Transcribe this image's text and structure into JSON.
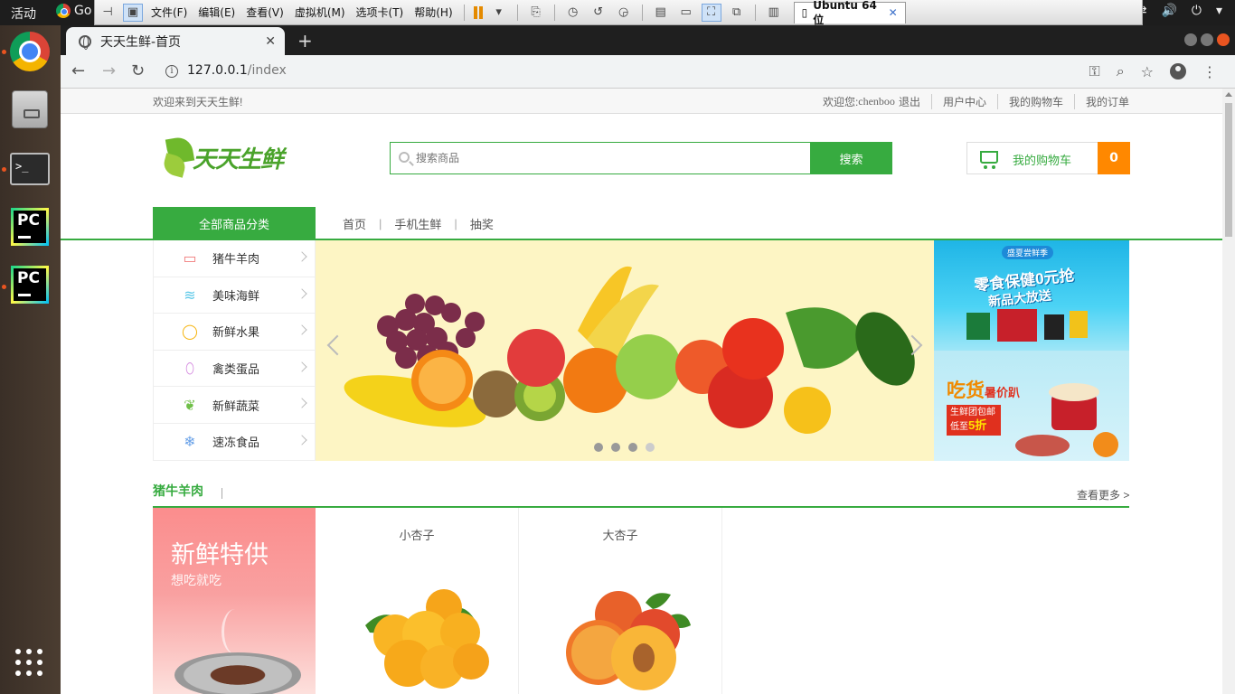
{
  "system": {
    "activities_label": "活动",
    "topbar_app_label": "Go"
  },
  "vmware": {
    "menus": [
      "文件(F)",
      "编辑(E)",
      "查看(V)",
      "虚拟机(M)",
      "选项卡(T)",
      "帮助(H)"
    ],
    "vm_tab_label": "Ubuntu 64 位"
  },
  "browser": {
    "tab_title": "天天生鲜-首页",
    "url_host": "127.0.0.1",
    "url_path": "/index"
  },
  "site": {
    "welcome": "欢迎来到天天生鲜!",
    "greeting": "欢迎您:",
    "username": "chenboo",
    "logout": "退出",
    "links": [
      "用户中心",
      "我的购物车",
      "我的订单"
    ],
    "logo_text": "天天生鲜",
    "search": {
      "placeholder": "搜索商品",
      "button": "搜索"
    },
    "cart": {
      "label": "我的购物车",
      "count": "0"
    },
    "all_categories": "全部商品分类",
    "nav": [
      "首页",
      "手机生鲜",
      "抽奖"
    ],
    "categories": [
      {
        "label": "猪牛羊肉",
        "icon": "meat-icon",
        "color": "#f07b7b"
      },
      {
        "label": "美味海鲜",
        "icon": "seafood-icon",
        "color": "#5cc8e8"
      },
      {
        "label": "新鲜水果",
        "icon": "fruit-icon",
        "color": "#f6b614"
      },
      {
        "label": "禽类蛋品",
        "icon": "egg-icon",
        "color": "#d58be0"
      },
      {
        "label": "新鲜蔬菜",
        "icon": "vegetable-icon",
        "color": "#6fbf47"
      },
      {
        "label": "速冻食品",
        "icon": "snowflake-icon",
        "color": "#6aa2e8"
      }
    ],
    "carousel": {
      "dots": 4,
      "active_dot": 4
    },
    "ads": {
      "ad1_tag": "盛夏尝鲜季",
      "ad1_title": "零食保健0元抢",
      "ad1_sub": "新品大放送",
      "ad2_title": "吃货",
      "ad2_title_small": "暑价趴",
      "ad2_box_line1": "生鲜团包邮",
      "ad2_box_line2": "低至",
      "ad2_box_discount": "5折"
    },
    "section": {
      "title": "猪牛羊肉",
      "more": "查看更多 >",
      "promo_title": "新鲜特供",
      "promo_sub": "想吃就吃",
      "products": [
        {
          "name": "小杏子"
        },
        {
          "name": "大杏子"
        }
      ]
    }
  },
  "colors": {
    "brand_green": "#37ab40",
    "cart_orange": "#ff8800"
  }
}
